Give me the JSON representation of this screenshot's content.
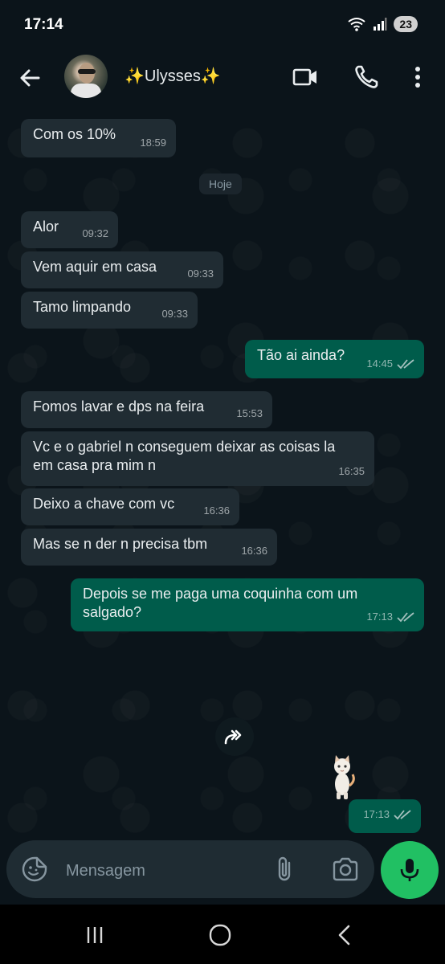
{
  "status": {
    "time": "17:14",
    "battery": "23"
  },
  "header": {
    "contact_name": "✨Ulysses✨"
  },
  "chat": {
    "date_label": "Hoje",
    "messages": [
      {
        "dir": "in",
        "text": "Com os 10%",
        "time": "18:59"
      },
      {
        "dir": "in",
        "text": "Alor",
        "time": "09:32"
      },
      {
        "dir": "in",
        "text": "Vem aquir em casa",
        "time": "09:33"
      },
      {
        "dir": "in",
        "text": "Tamo limpando",
        "time": "09:33"
      },
      {
        "dir": "out",
        "text": "Tão ai ainda?",
        "time": "14:45"
      },
      {
        "dir": "in",
        "text": "Fomos lavar e dps na feira",
        "time": "15:53"
      },
      {
        "dir": "in",
        "text": "Vc e o gabriel n conseguem deixar as coisas la em casa pra mim n",
        "time": "16:35"
      },
      {
        "dir": "in",
        "text": "Deixo a chave com vc",
        "time": "16:36"
      },
      {
        "dir": "in",
        "text": "Mas se n der n precisa tbm",
        "time": "16:36"
      },
      {
        "dir": "out",
        "text": "Depois se me paga uma coquinha com um salgado?",
        "time": "17:13"
      },
      {
        "dir": "out",
        "text": "",
        "time": "17:13"
      }
    ]
  },
  "composer": {
    "placeholder": "Mensagem"
  },
  "colors": {
    "incoming": "#202c33",
    "outgoing": "#005c4b",
    "accent": "#21c063",
    "background": "#0b141a"
  }
}
